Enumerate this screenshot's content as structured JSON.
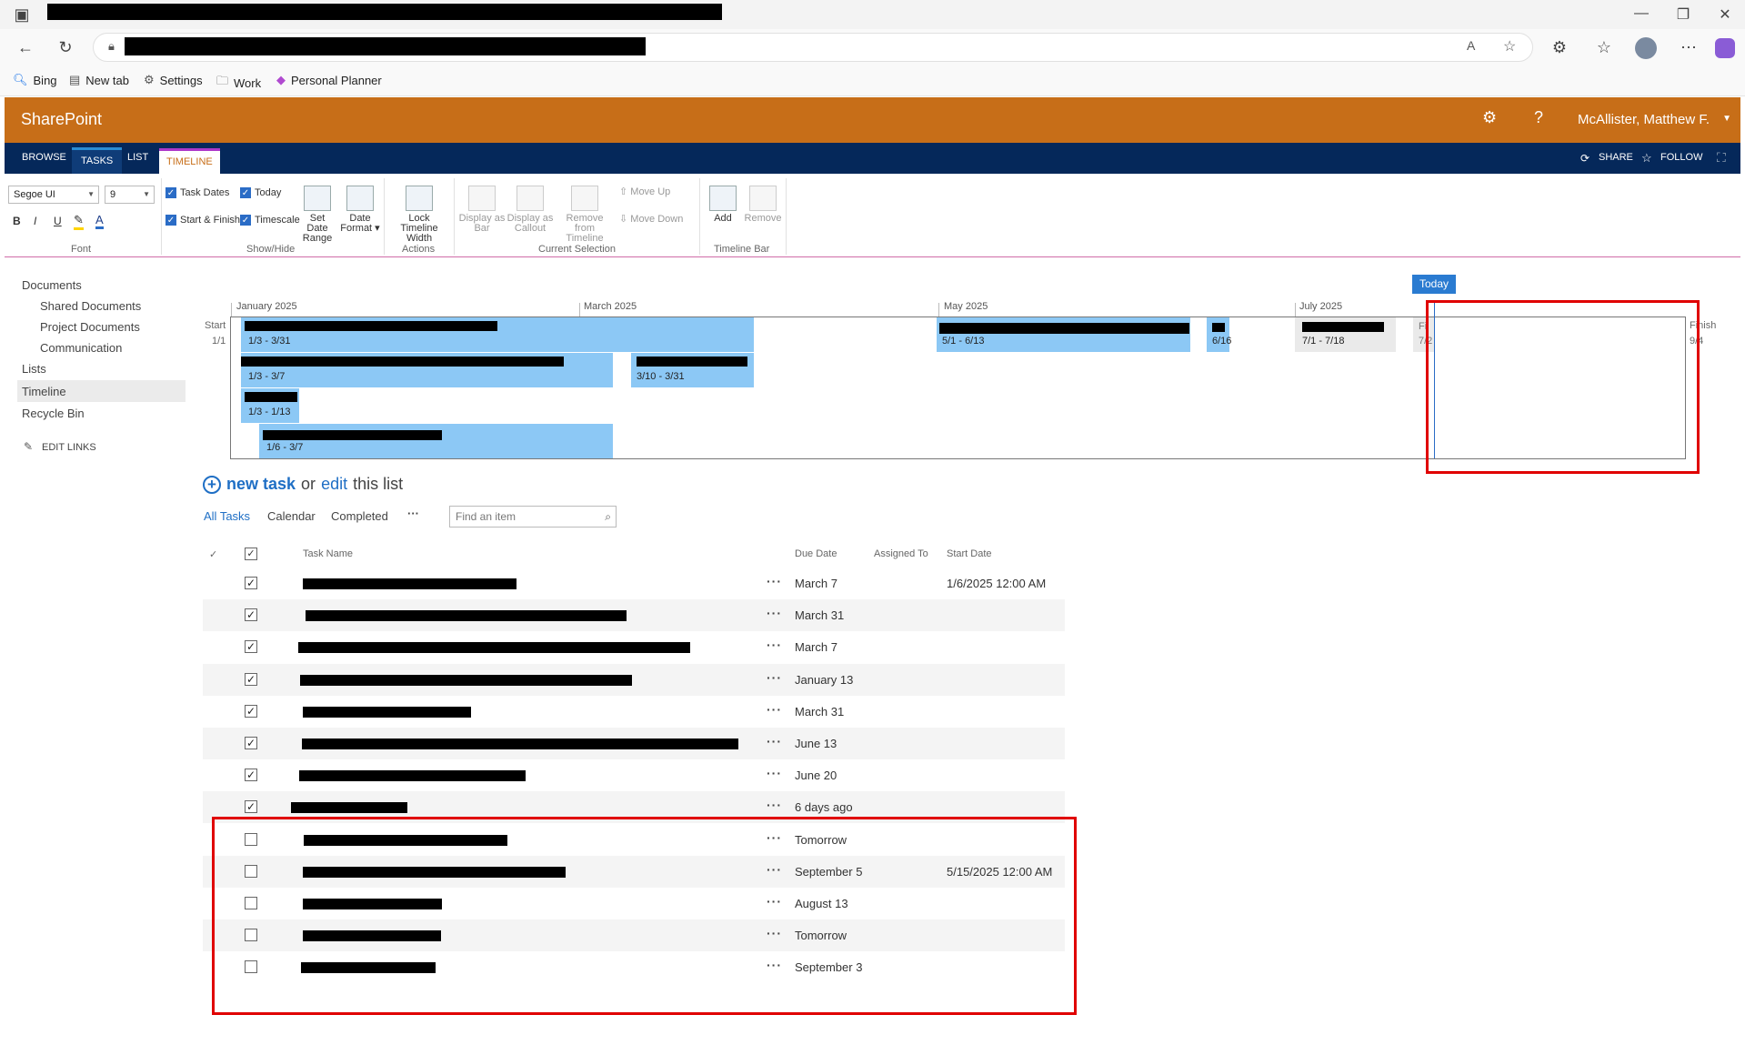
{
  "browser": {
    "favorites": [
      {
        "icon": "search-icon",
        "label": "Bing"
      },
      {
        "icon": "newtab-icon",
        "label": "New tab"
      },
      {
        "icon": "gear-icon",
        "label": "Settings"
      },
      {
        "icon": "folder-icon",
        "label": "Work"
      },
      {
        "icon": "planner-icon",
        "label": "Personal Planner"
      }
    ]
  },
  "suite": {
    "brand": "SharePoint",
    "user": "McAllister, Matthew F.",
    "brand_color": "#c76e18"
  },
  "ribbon": {
    "tabs": [
      "BROWSE",
      "TASKS",
      "LIST",
      "TIMELINE"
    ],
    "share": "SHARE",
    "follow": "FOLLOW",
    "font": {
      "family": "Segoe UI",
      "size": "9",
      "group_label": "Font"
    },
    "showhide": {
      "task_dates": "Task Dates",
      "today": "Today",
      "start_finish": "Start & Finish",
      "timescale": "Timescale",
      "set_date_range_1": "Set Date",
      "set_date_range_2": "Range",
      "date_format_1": "Date",
      "date_format_2": "Format",
      "group_label": "Show/Hide"
    },
    "actions": {
      "lock_1": "Lock Timeline",
      "lock_2": "Width",
      "group_label": "Actions"
    },
    "selection": {
      "display_bar_1": "Display as",
      "display_bar_2": "Bar",
      "display_callout_1": "Display as",
      "display_callout_2": "Callout",
      "remove_1": "Remove from",
      "remove_2": "Timeline",
      "move_up": "Move Up",
      "move_down": "Move Down",
      "group_label": "Current Selection"
    },
    "timeline_bar": {
      "add": "Add",
      "remove": "Remove",
      "group_label": "Timeline Bar"
    }
  },
  "nav": {
    "documents": "Documents",
    "shared_documents": "Shared Documents",
    "project_documents": "Project Documents",
    "communication": "Communication",
    "lists": "Lists",
    "timeline": "Timeline",
    "recycle_bin": "Recycle Bin",
    "edit_links": "EDIT LINKS"
  },
  "timeline": {
    "months": [
      "January 2025",
      "March 2025",
      "May 2025",
      "July 2025"
    ],
    "start_label": "Start",
    "start_date": "1/1",
    "finish_label": "Finish",
    "finish_date": "9/4",
    "today_label": "Today",
    "bars": [
      {
        "dates": "1/3 - 3/31"
      },
      {
        "dates": "1/3 - 3/7"
      },
      {
        "dates": "3/10 - 3/31"
      },
      {
        "dates": "1/3 - 1/13"
      },
      {
        "dates": "1/6 - 3/7"
      },
      {
        "dates": "5/1 - 6/13"
      },
      {
        "dates": "6/16"
      },
      {
        "dates": "7/1 - 7/18"
      },
      {
        "label": "Fi",
        "dates": "7/2"
      }
    ]
  },
  "list": {
    "new_task": "new task",
    "or": "or",
    "edit": "edit",
    "this_list": "this list",
    "views": [
      "All Tasks",
      "Calendar",
      "Completed"
    ],
    "more": "···",
    "search_placeholder": "Find an item",
    "columns": {
      "task_name": "Task Name",
      "due_date": "Due Date",
      "assigned_to": "Assigned To",
      "start_date": "Start Date"
    },
    "rows": [
      {
        "checked": true,
        "due": "March 7",
        "start": "1/6/2025 12:00 AM"
      },
      {
        "checked": true,
        "due": "March 31",
        "start": ""
      },
      {
        "checked": true,
        "due": "March 7",
        "start": ""
      },
      {
        "checked": true,
        "due": "January 13",
        "start": ""
      },
      {
        "checked": true,
        "due": "March 31",
        "start": ""
      },
      {
        "checked": true,
        "due": "June 13",
        "start": ""
      },
      {
        "checked": true,
        "due": "June 20",
        "start": ""
      },
      {
        "checked": true,
        "due": "6 days ago",
        "start": ""
      },
      {
        "checked": false,
        "due": "Tomorrow",
        "start": ""
      },
      {
        "checked": false,
        "due": "September 5",
        "start": "5/15/2025 12:00 AM"
      },
      {
        "checked": false,
        "due": "August 13",
        "start": ""
      },
      {
        "checked": false,
        "due": "Tomorrow",
        "start": ""
      },
      {
        "checked": false,
        "due": "September 3",
        "start": ""
      }
    ]
  }
}
